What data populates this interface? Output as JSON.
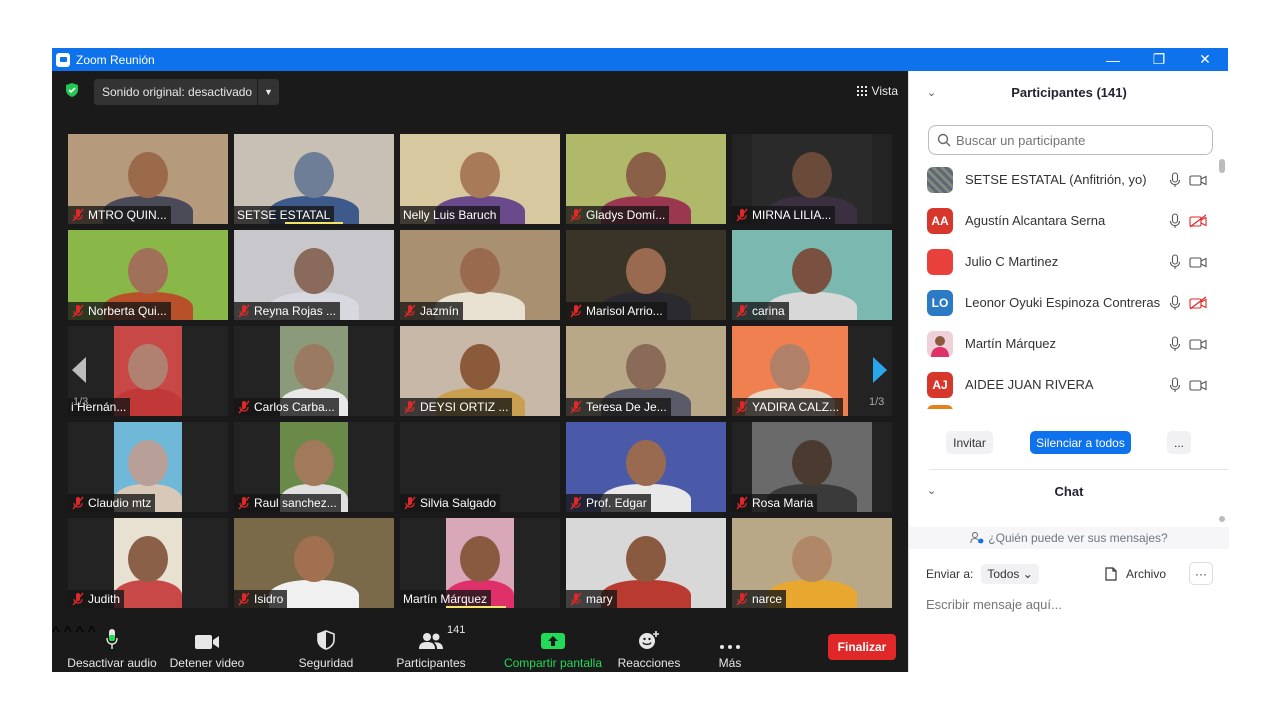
{
  "window": {
    "title": "Zoom Reunión",
    "controls": {
      "minimize": "—",
      "restore": "❐",
      "close": "✕"
    }
  },
  "topbar": {
    "sound_label": "Sonido original: desactivado",
    "sound_arrow": "▼",
    "view_label": "Vista"
  },
  "gallery": {
    "page_left": "1/3",
    "page_right": "1/3",
    "tiles": [
      {
        "name": "MTRO QUIN...",
        "muted": true,
        "bg": "#b59a7c",
        "skin": "#9a6a4a",
        "shirt": "#4a4a58"
      },
      {
        "name": "SETSE ESTATAL",
        "muted": false,
        "speaking": true,
        "bg": "#c8c0b4",
        "skin": "#6e7e96",
        "shirt": "#3d5a8a"
      },
      {
        "name": "Nelly Luis Baruch",
        "muted": false,
        "bg": "#d8c8a0",
        "skin": "#a87a58",
        "shirt": "#6a4a8a"
      },
      {
        "name": "Gladys Domí...",
        "muted": true,
        "bg": "#b0b86a",
        "skin": "#8a6048",
        "shirt": "#9a3850"
      },
      {
        "name": "MIRNA LILIA...",
        "muted": true,
        "bg": "#2a2a2a",
        "skin": "#6a4a38",
        "shirt": "#3a3040"
      },
      {
        "name": "Norberta Qui...",
        "muted": true,
        "bg": "#8ab848",
        "skin": "#a07058",
        "shirt": "#b8502a"
      },
      {
        "name": "Reyna Rojas ...",
        "muted": true,
        "bg": "#c8c8cc",
        "skin": "#8a6a5a",
        "shirt": "#d8d8e0"
      },
      {
        "name": "Jazmín",
        "muted": true,
        "bg": "#a89070",
        "skin": "#9a6a4e",
        "shirt": "#e8e0d0"
      },
      {
        "name": "Marisol Arrio...",
        "muted": true,
        "bg": "#3a3428",
        "skin": "#9a6a50",
        "shirt": "#2a2a30"
      },
      {
        "name": "carina",
        "muted": true,
        "bg": "#7ab8b0",
        "skin": "#7a5040",
        "shirt": "#d8d8d8"
      },
      {
        "name": "i Hernán...",
        "muted": false,
        "bg": "#c84848",
        "skin": "#b08070",
        "shirt": "#c03838"
      },
      {
        "name": "Carlos Carba...",
        "muted": true,
        "bg": "#8a9a7a",
        "skin": "#9a7a60",
        "shirt": "#e8e8e8"
      },
      {
        "name": "DEYSI ORTIZ ...",
        "muted": true,
        "bg": "#c8b8a8",
        "skin": "#8a5a3a",
        "shirt": "#c8a050"
      },
      {
        "name": "Teresa De Je...",
        "muted": true,
        "bg": "#b8a888",
        "skin": "#8a6a58",
        "shirt": "#5a5a68"
      },
      {
        "name": "YADIRA CALZ...",
        "muted": true,
        "bg": "#f08050",
        "skin": "#b08068",
        "shirt": "#e8d8c8"
      },
      {
        "name": "Claudio mtz",
        "muted": true,
        "bg": "#70b8d8",
        "skin": "#b8a098",
        "shirt": "#d8c8b8"
      },
      {
        "name": "Raul sanchez...",
        "muted": true,
        "bg": "#6a8a4a",
        "skin": "#a07a5a",
        "shirt": "#e0e0e0"
      },
      {
        "name": "Silvia Salgado",
        "muted": true,
        "bg": "#232323",
        "skin": "#232323",
        "shirt": "#232323"
      },
      {
        "name": "Prof. Edgar",
        "muted": true,
        "bg": "#4a5aa8",
        "skin": "#9a6a50",
        "shirt": "#e8e8e8"
      },
      {
        "name": "Rosa Maria",
        "muted": true,
        "bg": "#6a6a6a",
        "skin": "#4a3a30",
        "shirt": "#3a3a3a"
      },
      {
        "name": "Judith",
        "muted": true,
        "bg": "#e8e0d0",
        "skin": "#8a6048",
        "shirt": "#c84848"
      },
      {
        "name": "Isidro",
        "muted": true,
        "bg": "#7a6a4a",
        "skin": "#a07050",
        "shirt": "#f0f0f0"
      },
      {
        "name": "Martín Márquez",
        "muted": false,
        "speaking": true,
        "bg": "#d8a8b8",
        "skin": "#8a5a40",
        "shirt": "#e0306a"
      },
      {
        "name": "mary",
        "muted": true,
        "bg": "#d8d8d8",
        "skin": "#8a5a40",
        "shirt": "#b83a30"
      },
      {
        "name": "narce",
        "muted": true,
        "bg": "#b8a888",
        "skin": "#b08868",
        "shirt": "#e8a830"
      }
    ]
  },
  "toolbar": {
    "audio_label": "Desactivar audio",
    "video_label": "Detener video",
    "security_label": "Seguridad",
    "participants_label": "Participantes",
    "participants_count": "141",
    "share_label": "Compartir pantalla",
    "reactions_label": "Reacciones",
    "more_label": "Más",
    "end_label": "Finalizar",
    "caret": "^"
  },
  "participants_panel": {
    "header_chevron": "⌄",
    "title": "Participantes (141)",
    "search_placeholder": "Buscar un participante",
    "participants": [
      {
        "name": "SETSE ESTATAL (Anfitrión, yo)",
        "initials": "",
        "color": "#6b6b6b",
        "photo": true,
        "video_off": false
      },
      {
        "name": "Agustín Alcantara Serna",
        "initials": "AA",
        "color": "#d7372b",
        "video_off": true
      },
      {
        "name": "Julio C Martinez",
        "initials": "",
        "color": "#e8403a",
        "video_off": false
      },
      {
        "name": "Leonor Oyuki Espinoza Contreras",
        "initials": "LO",
        "color": "#2a7ac4",
        "video_off": true
      },
      {
        "name": "Martín Márquez",
        "initials": "",
        "color": "#f0d0d8",
        "photo": true,
        "video_off": false
      },
      {
        "name": "AIDEE JUAN RIVERA",
        "initials": "AJ",
        "color": "#d7372b",
        "video_off": false
      }
    ],
    "invite_label": "Invitar",
    "mute_all_label": "Silenciar a todos",
    "more_label": "..."
  },
  "chat": {
    "chevron": "⌄",
    "title": "Chat",
    "who_can_see": "¿Quién puede ver sus mensajes?",
    "send_to_label": "Enviar a:",
    "send_to_value": "Todos",
    "send_to_arrow": "⌄",
    "file_label": "Archivo",
    "more_label": "···",
    "input_placeholder": "Escribir mensaje aquí..."
  },
  "colors": {
    "zoom_blue": "#0e72ed",
    "end_red": "#e02828",
    "share_green": "#23d959",
    "speaking_yellow": "#f2e36a",
    "mute_red": "#e02828"
  }
}
